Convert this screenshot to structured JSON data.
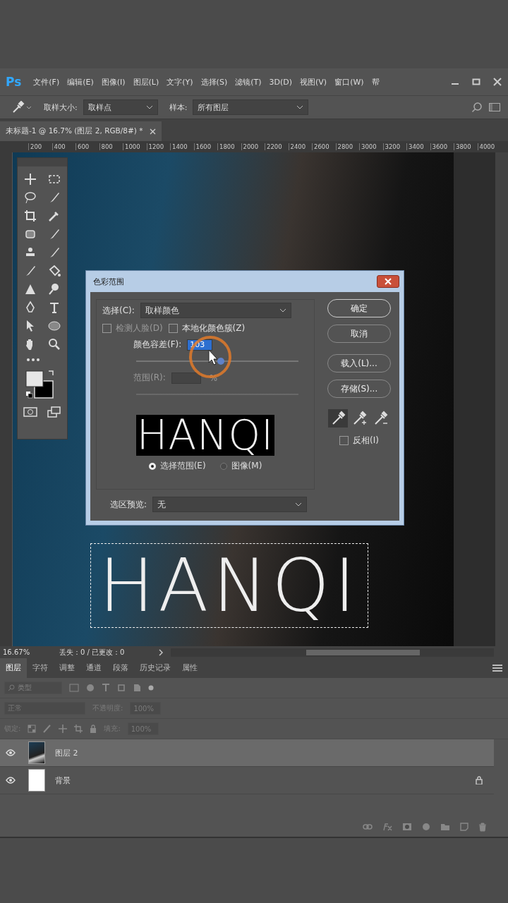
{
  "menu_bar": {
    "logo": "Ps",
    "items": [
      "文件(F)",
      "编辑(E)",
      "图像(I)",
      "图层(L)",
      "文字(Y)",
      "选择(S)",
      "滤镜(T)",
      "3D(D)",
      "视图(V)",
      "窗口(W)",
      "帮"
    ]
  },
  "options_bar": {
    "sample_size_label": "取样大小:",
    "sample_size": "取样点",
    "sample_label": "样本:",
    "sample": "所有图层"
  },
  "document_tab": {
    "title": "未标题-1 @ 16.7% (图层 2, RGB/8#) *"
  },
  "ruler": [
    "200",
    "400",
    "600",
    "800",
    "1000",
    "1200",
    "1400",
    "1600",
    "1800",
    "2000",
    "2200",
    "2400",
    "2600",
    "2800",
    "3000",
    "3200",
    "3400",
    "3600",
    "3800",
    "4000"
  ],
  "canvas": {
    "text_layer": "HANQI"
  },
  "dialog": {
    "title": "色彩范围",
    "select_label": "选择(C):",
    "select_value": "取样颜色",
    "detect_faces": {
      "label": "检测人脸(D)",
      "checked": false,
      "disabled": true
    },
    "localized": {
      "label": "本地化颜色簇(Z)",
      "checked": false
    },
    "fuzziness": {
      "label": "颜色容差(F):",
      "value": "103",
      "level": 0.52
    },
    "range": {
      "label": "范围(R):",
      "unit": "%",
      "disabled": true
    },
    "preview_text": "HANQI",
    "view_options": [
      {
        "label": "选择范围(E)",
        "selected": true
      },
      {
        "label": "图像(M)",
        "selected": false
      }
    ],
    "buttons": [
      "确定",
      "取消",
      "载入(L)...",
      "存储(S)..."
    ],
    "eyedroppers": [
      {
        "selected": true
      },
      {
        "selected": false
      },
      {
        "selected": false
      }
    ],
    "invert": {
      "label": "反相(I)",
      "checked": false
    },
    "selection_preview": {
      "label": "选区预览:",
      "value": "无"
    }
  },
  "status_bar": {
    "zoom": "16.67%",
    "info": "丢失：0 / 已更改：0"
  },
  "panel_tabs": [
    {
      "label": "图层",
      "selected": true
    },
    {
      "label": "字符",
      "selected": false
    },
    {
      "label": "调整",
      "selected": false
    },
    {
      "label": "通道",
      "selected": false
    },
    {
      "label": "段落",
      "selected": false
    },
    {
      "label": "历史记录",
      "selected": false
    },
    {
      "label": "属性",
      "selected": false
    }
  ],
  "layers_panel": {
    "filter_placeholder": "类型",
    "blend_mode": "正常",
    "opacity_label": "不透明度:",
    "opacity": "100%",
    "lock_label": "锁定:",
    "fill_label": "填充:",
    "fill": "100%",
    "layers": [
      {
        "name": "图层 2",
        "kind": "photo",
        "selected": true,
        "visible": true,
        "locked": false
      },
      {
        "name": "背景",
        "kind": "white",
        "selected": false,
        "visible": true,
        "locked": true
      }
    ]
  }
}
